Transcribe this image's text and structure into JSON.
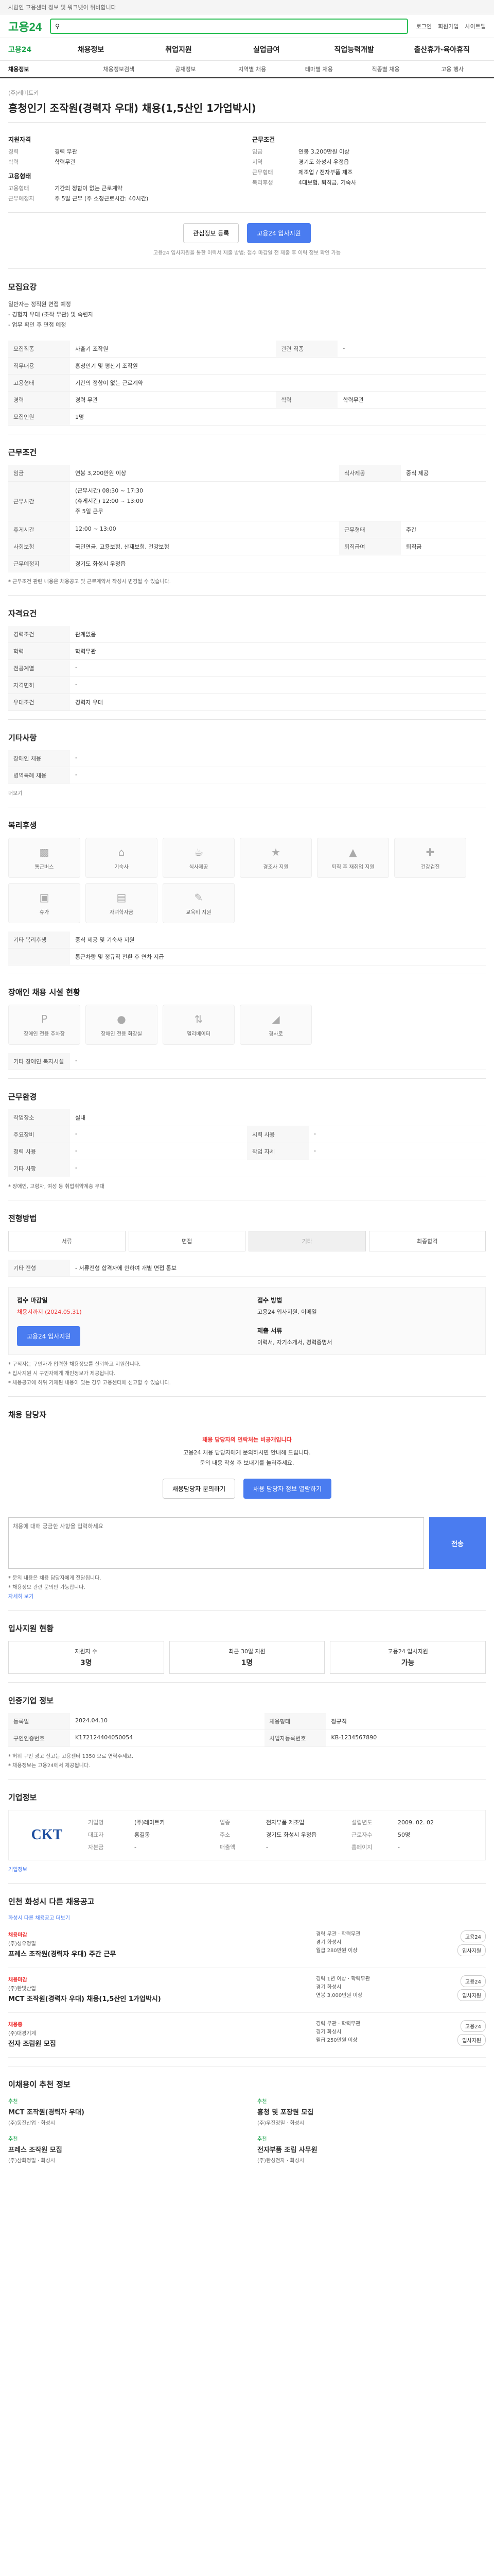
{
  "topbar": {
    "text": "사람인 고용센터 정보 및 워크넷이 뒤비합니다"
  },
  "header": {
    "logo": "고용24",
    "search_placeholder": "",
    "links": [
      "로그인",
      "회원가입",
      "사이트맵"
    ]
  },
  "mainnav": {
    "home": "고용24",
    "items": [
      "채용정보",
      "취업지원",
      "실업급여",
      "직업능력개발",
      "출산휴가·육아휴직"
    ]
  },
  "subnav": {
    "current": "채용정보",
    "items": [
      "채용정보검색",
      "공채정보",
      "지역별 채용",
      "테마별 채용",
      "직종별 채용",
      "고용 행사"
    ]
  },
  "job": {
    "company": "(주)레미트키",
    "title": "흥청인기 조작원(경력자 우대) 채용(1,5산인 1가업박시)",
    "summary_left_title": "지원자격",
    "summary_left": [
      {
        "k": "경력",
        "v": "경력 무관"
      },
      {
        "k": "학력",
        "v": "학력무관"
      }
    ],
    "summary_left2_title": "고용형태",
    "summary_left2": [
      {
        "k": "고용형태",
        "v": "기간의 정함이 없는 근로계약"
      },
      {
        "k": "근무예정지",
        "v": "주 5일 근무 (주 소정근로시간: 40시간)"
      }
    ],
    "summary_right_title": "근무조건",
    "summary_right": [
      {
        "k": "임금",
        "v": "연봉 3,200만원 이상"
      },
      {
        "k": "지역",
        "v": "경기도 화성시 우정읍"
      },
      {
        "k": "근무형태",
        "v": "제조업 / 전자부품 제조"
      }
    ],
    "summary_right2": [
      {
        "k": "복리후생",
        "v": "4대보험, 퇴직금, 기숙사"
      }
    ],
    "btn_save": "관심정보 등록",
    "btn_apply": "고용24 입사지원",
    "notice": "고용24 입사지원을 통한 이력서 제출 방법: 접수 마감일 전 제출 후 이력 정보 확인 가능"
  },
  "recruit": {
    "title": "모집요강",
    "desc": "일반자는 정직원 면접 예정\n- 경험자 우대 (조작 무관) 및 숙련자\n- 업무 확인 후 면접 예정",
    "rows": [
      {
        "k": "모집직종",
        "v": "사출기 조작원",
        "k2": "관련 직종",
        "v2": "-"
      },
      {
        "k": "직무내용",
        "v": "흥청인기 및 평산기 조작원",
        "k2": "",
        "v2": ""
      },
      {
        "k": "고용형태",
        "v": "기간의 정함이 없는 근로계약",
        "k2": "",
        "v2": ""
      },
      {
        "k": "경력",
        "v": "경력 무관",
        "k2": "학력",
        "v2": "학력무관"
      },
      {
        "k": "모집인원",
        "v": "1명",
        "k2": "",
        "v2": ""
      }
    ]
  },
  "conditions": {
    "title": "근무조건",
    "rows": [
      {
        "k": "임금",
        "v": "연봉 3,200만원 이상",
        "k2": "식사제공",
        "v2": "중식 제공"
      },
      {
        "k": "근무시간",
        "v": "(근무시간) 08:30 ~ 17:30\n(휴게시간) 12:00 ~ 13:00\n주 5일 근무",
        "k2": "",
        "v2": ""
      },
      {
        "k": "휴게시간",
        "v": "12:00 ~ 13:00",
        "k2": "근무형태",
        "v2": "주간"
      },
      {
        "k": "사회보험",
        "v": "국민연금, 고용보험, 산재보험, 건강보험",
        "k2": "퇴직급여",
        "v2": "퇴직금"
      },
      {
        "k": "근무예정지",
        "v": "경기도 화성시 우정읍",
        "k2": "",
        "v2": ""
      }
    ],
    "note": "* 근무조건 관련 내용은 채용공고 및 근로계약서 작성시 변경될 수 있습니다."
  },
  "qualification": {
    "title": "자격요건",
    "rows": [
      {
        "k": "경력조건",
        "v": "관계없음"
      },
      {
        "k": "학력",
        "v": "학력무관"
      },
      {
        "k": "전공계열",
        "v": "-"
      },
      {
        "k": "자격면허",
        "v": "-"
      },
      {
        "k": "우대조건",
        "v": "경력자 우대"
      }
    ]
  },
  "misc": {
    "title": "기타사항",
    "rows": [
      {
        "k": "장애인 채용",
        "v": "-"
      },
      {
        "k": "병역특례 채용",
        "v": "-"
      }
    ],
    "more_label": "더보기"
  },
  "welfare": {
    "title": "복리후생",
    "items": [
      "통근버스",
      "기숙사",
      "식사제공",
      "경조사 지원",
      "퇴직 후 재취업 지원",
      "건강검진",
      "휴가",
      "자녀학자금",
      "교육비 지원"
    ],
    "subtitle": "기타 복리후생",
    "text": "중식 제공 및 기숙사 지원",
    "extra": "통근차량 및 정규직 전환 후 연차 지급"
  },
  "disabled": {
    "title": "장애인 채용 시설 현황",
    "items": [
      "장애인 전용 주차장",
      "장애인 전용 화장실",
      "엘리베이터",
      "경사로"
    ],
    "subtitle": "기타 장애인 복지시설",
    "text": "-"
  },
  "workplace": {
    "title": "근무환경",
    "rows": [
      {
        "k": "작업장소",
        "v": "실내",
        "k2": "",
        "v2": ""
      },
      {
        "k": "주요장비",
        "v": "-",
        "k2": "시력 사용",
        "v2": "-"
      },
      {
        "k": "청력 사용",
        "v": "-",
        "k2": "작업 자세",
        "v2": "-"
      },
      {
        "k": "기타 사항",
        "v": "-",
        "k2": "",
        "v2": ""
      }
    ],
    "note": "* 장애인, 고령자, 여성 등 취업취약계층 우대"
  },
  "process": {
    "title": "전형방법",
    "steps": [
      "서류",
      "면접",
      "기타",
      "최종합격"
    ],
    "subtitle": "기타 전형",
    "text": "- 서류전형 합격자에 한하여 개별 면접 통보",
    "apply_title": "접수 마감일",
    "apply_date": "채용시까지 (2024.05.31)",
    "apply_method_title": "접수 방법",
    "apply_methods": "고용24 입사지원, 이메일",
    "apply_btn": "고용24 입사지원",
    "docs_title": "제출 서류",
    "docs": "이력서, 자기소개서, 경력증명서",
    "notes": [
      "* 구직자는 구인자가 입력한 채용정보를 신뢰하고 지원합니다.",
      "* 입사지원 시 구인자에게 개인정보가 제공됩니다.",
      "* 채용공고에 허위 기재된 내용이 있는 경우 고용센터에 신고할 수 있습니다."
    ]
  },
  "manager": {
    "title": "채용 담당자",
    "warn": "채용 담당자의 연락처는 비공개입니다",
    "text": "고용24 채용 담당자에게 문의하시면 안내해 드립니다.\n문의 내용 작성 후 보내기를 눌러주세요.",
    "btn_left": "채용담당자 문의하기",
    "btn_right": "채용 담당자 정보 열람하기",
    "q_placeholder": "채용에 대해 궁금한 사항을 입력하세요",
    "send": "전송",
    "q_notes": [
      "* 문의 내용은 채용 담당자에게 전달됩니다.",
      "* 채용정보 관련 문의만 가능합니다."
    ],
    "more": "자세히 보기"
  },
  "applicants": {
    "title": "입사지원 현황",
    "stats": [
      {
        "label": "지원자 수",
        "value": "3명"
      },
      {
        "label": "최근 30일 지원",
        "value": "1명"
      },
      {
        "label": "고용24 입사지원",
        "value": "가능"
      }
    ]
  },
  "info": {
    "title": "인증기업 정보",
    "rows": [
      {
        "k": "등록일",
        "v": "2024.04.10",
        "k2": "채용형태",
        "v2": "정규직"
      },
      {
        "k": "구인인증번호",
        "v": "K172124404050054",
        "k2": "사업자등록번호",
        "v2": "KB-1234567890"
      }
    ],
    "notes": [
      "* 허위 구인 광고 신고는 고용센터 1350 으로 연락주세요.",
      "* 채용정보는 고용24에서 제공됩니다."
    ]
  },
  "company": {
    "title": "기업정보",
    "more": "기업정보",
    "logo_text": "CKT",
    "fields": [
      {
        "k": "기업명",
        "v": "(주)레미트키"
      },
      {
        "k": "업종",
        "v": "전자부품 제조업"
      },
      {
        "k": "설립년도",
        "v": "2009. 02. 02"
      },
      {
        "k": "대표자",
        "v": "홍길동"
      },
      {
        "k": "주소",
        "v": "경기도 화성시 우정읍"
      },
      {
        "k": "근로자수",
        "v": "50명"
      },
      {
        "k": "자본금",
        "v": "-"
      },
      {
        "k": "매출액",
        "v": "-"
      },
      {
        "k": "홈페이지",
        "v": "-"
      }
    ]
  },
  "related": {
    "title": "인천 화성시 다른 채용공고",
    "more": "화성시 다른 채용공고 더보기",
    "jobs": [
      {
        "badge": "채용마감",
        "company": "(주)성우정밀",
        "title": "프레스 조작원(경력자 우대) 주간 근무",
        "meta": "경력 무관 · 학력무관\n경기 화성시\n월급 280만원 이상",
        "chips": [
          "고용24",
          "입사지원"
        ]
      },
      {
        "badge": "채용마감",
        "company": "(주)한빛산업",
        "title": "MCT 조작원(경력자 우대) 채용(1,5산인 1가업박시)",
        "meta": "경력 1년 이상 · 학력무관\n경기 화성시\n연봉 3,000만원 이상",
        "chips": [
          "고용24",
          "입사지원"
        ]
      },
      {
        "badge": "채용중",
        "company": "(주)대경기계",
        "title": "전자 조립원 모집",
        "meta": "경력 무관 · 학력무관\n경기 화성시\n월급 250만원 이상",
        "chips": [
          "고용24",
          "입사지원"
        ]
      }
    ]
  },
  "recommend": {
    "title": "이채용이 추천 정보",
    "items": [
      {
        "badge": "추천",
        "title": "MCT 조작원(경력자 우대)",
        "meta": "(주)동진산업 · 화성시"
      },
      {
        "badge": "추천",
        "title": "흥청 및 포장원 모집",
        "meta": "(주)우진정밀 · 화성시"
      },
      {
        "badge": "추천",
        "title": "프레스 조작원 모집",
        "meta": "(주)삼화정밀 · 화성시"
      },
      {
        "badge": "추천",
        "title": "전자부품 조립 사무원",
        "meta": "(주)한성전자 · 화성시"
      }
    ]
  }
}
